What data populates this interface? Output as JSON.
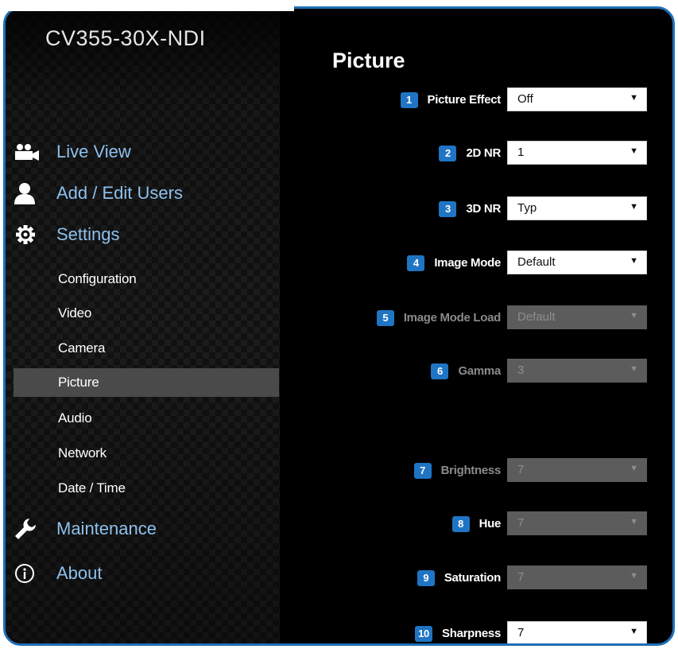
{
  "app": {
    "brand": "CV355-30X-NDI"
  },
  "sidebar": {
    "main_items": [
      {
        "label": "Live View",
        "icon": "video-camera-icon"
      },
      {
        "label": "Add / Edit Users",
        "icon": "user-icon"
      },
      {
        "label": "Settings",
        "icon": "gear-icon"
      },
      {
        "label": "Maintenance",
        "icon": "wrench-icon"
      },
      {
        "label": "About",
        "icon": "info-icon"
      }
    ],
    "sub_items": [
      {
        "label": "Configuration"
      },
      {
        "label": "Video"
      },
      {
        "label": "Camera"
      },
      {
        "label": "Picture",
        "active": true
      },
      {
        "label": "Audio"
      },
      {
        "label": "Network"
      },
      {
        "label": "Date / Time"
      }
    ]
  },
  "main": {
    "title": "Picture",
    "fields": [
      {
        "num": "1",
        "label": "Picture Effect",
        "value": "Off",
        "enabled": true
      },
      {
        "num": "2",
        "label": "2D NR",
        "value": "1",
        "enabled": true
      },
      {
        "num": "3",
        "label": "3D NR",
        "value": "Typ",
        "enabled": true
      },
      {
        "num": "4",
        "label": "Image Mode",
        "value": "Default",
        "enabled": true
      },
      {
        "num": "5",
        "label": "Image Mode Load",
        "value": "Default",
        "enabled": false
      },
      {
        "num": "6",
        "label": "Gamma",
        "value": "3",
        "enabled": false
      },
      {
        "num": "7",
        "label": "Brightness",
        "value": "7",
        "enabled": false
      },
      {
        "num": "8",
        "label": "Hue",
        "value": "7",
        "enabled": false
      },
      {
        "num": "9",
        "label": "Saturation",
        "value": "7",
        "enabled": false
      },
      {
        "num": "10",
        "label": "Sharpness",
        "value": "7",
        "enabled": true
      }
    ]
  },
  "colors": {
    "accent": "#1f75c4",
    "nav_label": "#8ec0ee",
    "active_item_bg": "#4a4a4a",
    "frame_border": "#1f6fb5"
  }
}
